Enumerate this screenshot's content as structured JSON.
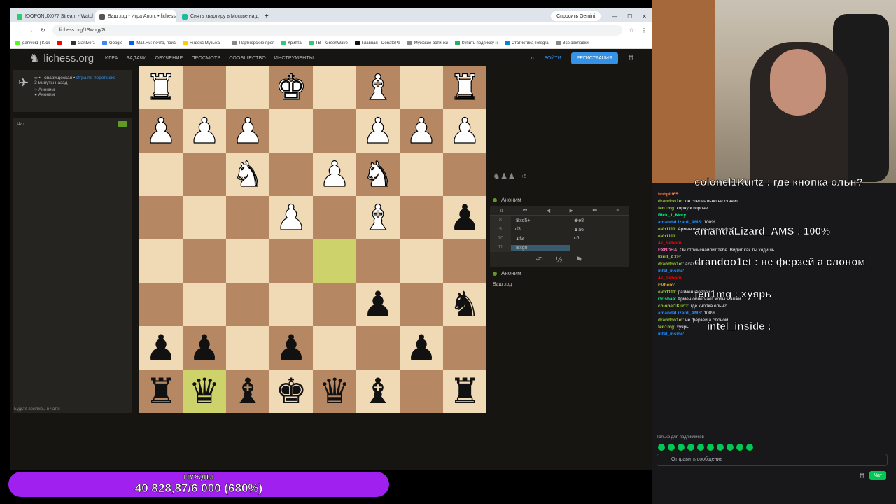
{
  "browser": {
    "tabs": [
      {
        "label": "ЮОРОNUX077 Stream - Watch",
        "color": "#2ecc71"
      },
      {
        "label": "Ваш ход - Игра Anon. • lichess",
        "color": "#555"
      },
      {
        "label": "Снять квартиру в Москве на д",
        "color": "#1abc9c"
      }
    ],
    "gemini": "Спросить Gemini",
    "url": "lichess.org/1Swogy2t",
    "bookmarks": [
      {
        "label": "ganiver1 | Kick",
        "color": "#53fc18"
      },
      {
        "label": "",
        "color": "#ff0000"
      },
      {
        "label": "Gantver1",
        "color": "#333"
      },
      {
        "label": "Google",
        "color": "#4285f4"
      },
      {
        "label": "Mail.Ru: почта, поис",
        "color": "#005ff9"
      },
      {
        "label": "Яндекс Музыка —",
        "color": "#ffcc00"
      },
      {
        "label": "Партнерские прог",
        "color": "#888"
      },
      {
        "label": "Крипта",
        "color": "#2ecc71"
      },
      {
        "label": "TB – GreenWave",
        "color": "#2ecc71"
      },
      {
        "label": "Главная - DonatePa",
        "color": "#111"
      },
      {
        "label": "Мужские ботинки",
        "color": "#888"
      },
      {
        "label": "Купить подписку н",
        "color": "#27ae60"
      },
      {
        "label": "Статистика Telegra",
        "color": "#0088cc"
      },
      {
        "label": "Все закладки",
        "color": "#888"
      }
    ]
  },
  "lichess": {
    "logo": "lichess.org",
    "nav": [
      "ИГРА",
      "ЗАДАЧИ",
      "ОБУЧЕНИЕ",
      "ПРОСМОТР",
      "СООБЩЕСТВО",
      "ИНСТРУМЕНТЫ"
    ],
    "signin": "ВОЙТИ",
    "register": "РЕГИСТРАЦИЯ",
    "game_type": "∞ • Товарищеская • ",
    "game_type_link": "Игра по переписке",
    "time_ago": "3 минуты назад",
    "player1": "Аноним",
    "player2": "Аноним",
    "chat_title": "Чат",
    "chat_placeholder": "Будьте вежливы в чате!",
    "captured": "♞♟♟",
    "captured_score": "+5",
    "top_player": "Аноним",
    "bottom_player": "Аноним",
    "your_turn": "Ваш ход",
    "moves": [
      {
        "n": "8",
        "w": "♛xd5+",
        "b": "♚e8"
      },
      {
        "n": "9",
        "w": "d3",
        "b": "♝a6"
      },
      {
        "n": "10",
        "w": "♝f3",
        "b": "c6"
      },
      {
        "n": "11",
        "w": "♛xg8",
        "b": ""
      }
    ]
  },
  "board": [
    [
      "wR",
      "",
      "",
      "wK",
      "",
      "wB",
      "",
      "wR"
    ],
    [
      "wP",
      "wP",
      "wP",
      "",
      "",
      "wP",
      "wP",
      "wP"
    ],
    [
      "",
      "",
      "wN",
      "",
      "wP",
      "wN",
      "",
      ""
    ],
    [
      "",
      "",
      "",
      "wP",
      "",
      "wB",
      "",
      "bP"
    ],
    [
      "",
      "",
      "",
      "",
      "",
      "",
      "",
      ""
    ],
    [
      "",
      "",
      "",
      "",
      "",
      "bP",
      "",
      "bN"
    ],
    [
      "bP",
      "bP",
      "",
      "bP",
      "",
      "",
      "bP",
      ""
    ],
    [
      "bR",
      "bQ",
      "bB",
      "bK",
      "bQ",
      "bB",
      "",
      "bR"
    ]
  ],
  "highlights": [
    [
      4,
      4
    ],
    [
      7,
      1
    ]
  ],
  "twitch_chat": {
    "messages": [
      {
        "user": "hohpid65",
        "color": "#ff7f50",
        "text": ""
      },
      {
        "user": "drandoo1et",
        "color": "#9acd32",
        "text": "он специально не ставит"
      },
      {
        "user": "fen1mg",
        "color": "#9acd32",
        "text": "корну к короне"
      },
      {
        "user": "Rick_1_Mory",
        "color": "#00ff7f",
        "text": ""
      },
      {
        "user": "amandaLizard_AMS",
        "color": "#1e90ff",
        "text": "100%"
      },
      {
        "user": "eVo1111",
        "color": "#9acd32",
        "text": "Армен пешки назад не рубят"
      },
      {
        "user": "eVo1111",
        "color": "#9acd32",
        "text": ""
      },
      {
        "user": "4k_Reborn",
        "color": "#ff0000",
        "text": ""
      },
      {
        "user": "EXNDHA",
        "color": "#ff69b4",
        "text": "Он стримснайпит тебя. Видит как ты ходишь"
      },
      {
        "user": "Kirill_AXE",
        "color": "#9acd32",
        "text": ""
      },
      {
        "user": "drandoo1et",
        "color": "#9acd32",
        "text": "ахахаха"
      },
      {
        "user": "intel_inside",
        "color": "#1e90ff",
        "text": ""
      },
      {
        "user": "4k_Reborn",
        "color": "#ff0000",
        "text": ""
      },
      {
        "user": "EVhero",
        "color": "#daa520",
        "text": ""
      },
      {
        "user": "eVo1111",
        "color": "#9acd32",
        "text": "размен ферзей"
      },
      {
        "user": "Grishaa",
        "color": "#00ff7f",
        "text": "Армен облегчает ходы Сашки"
      },
      {
        "user": "colonel1Kurtz",
        "color": "#9acd32",
        "text": "где кнопка ольн?"
      },
      {
        "user": "amandaLizard_AMS",
        "color": "#1e90ff",
        "text": "100%"
      },
      {
        "user": "drandoo1et",
        "color": "#9acd32",
        "text": "не ферзей а слоном"
      },
      {
        "user": "fen1mg",
        "color": "#9acd32",
        "text": "хуярь"
      },
      {
        "user": "intel_inside",
        "color": "#1e90ff",
        "text": ""
      }
    ],
    "overlays": [
      {
        "text": "colonel1Kurtz : где кнопка ольн?",
        "size": 15
      },
      {
        "text": "amandaLizard_AMS : 100%",
        "size": 15
      },
      {
        "text": "drandoo1et : не ферзей а слоном",
        "size": 15
      },
      {
        "text": "fen1mg : хуярь",
        "size": 15
      },
      {
        "text": "intel_inside :",
        "size": 15
      }
    ],
    "sub_only": "Только для подписчиков",
    "input_placeholder": "Отправить сообщение",
    "chat_button": "Чат"
  },
  "banner": {
    "title": "НУЖДЫ",
    "amount": "40 828,87/6 000 (680%)"
  },
  "colors": {
    "board_light": "#f0d9b5",
    "board_dark": "#b58863",
    "highlight": "#cdd26a",
    "lichess_blue": "#3692e7",
    "banner": "#a020f0"
  }
}
